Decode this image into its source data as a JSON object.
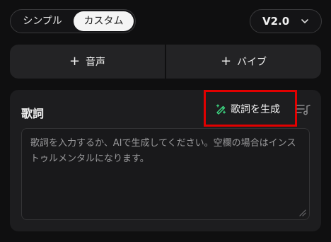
{
  "mode_toggle": {
    "simple_label": "シンプル",
    "custom_label": "カスタム",
    "selected": "カスタム"
  },
  "version_select": {
    "value": "V2.0",
    "icon": "chevron-down-icon"
  },
  "add_buttons": {
    "vocal_label": "音声",
    "vibe_label": "バイブ",
    "icon": "plus-icon"
  },
  "lyrics": {
    "title": "歌詞",
    "generate_label": "歌詞を生成",
    "generate_icon": "magic-pen-icon",
    "music_icon": "music-list-icon",
    "placeholder": "歌詞を入力するか、AIで生成してください。空欄の場合はインストゥルメンタルになります。"
  },
  "colors": {
    "background": "#0f0f10",
    "card": "#1d1d1f",
    "highlight_box": "#e10000",
    "accent_green": "#3ddc84"
  }
}
